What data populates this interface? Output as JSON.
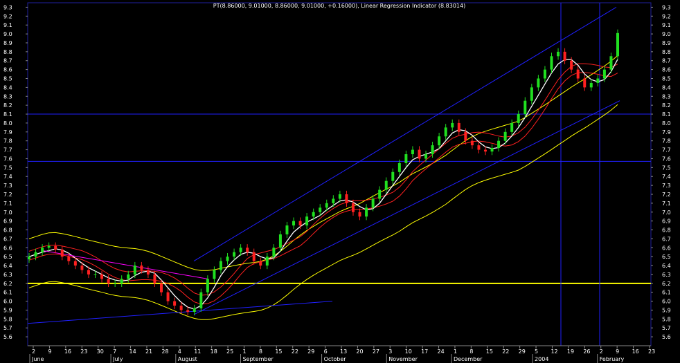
{
  "chart_data": {
    "type": "candlestick",
    "title": "PT(8.86000, 9.01000, 8.86000, 9.01000, +0.16000), Linear Regression Indicator (8.83014)",
    "ylim": [
      5.5,
      9.35
    ],
    "y_ticks": [
      5.6,
      5.7,
      5.8,
      5.9,
      6.0,
      6.1,
      6.2,
      6.3,
      6.4,
      6.5,
      6.6,
      6.7,
      6.8,
      6.9,
      7.0,
      7.1,
      7.2,
      7.3,
      7.4,
      7.5,
      7.6,
      7.7,
      7.8,
      7.9,
      8.0,
      8.1,
      8.2,
      8.3,
      8.4,
      8.5,
      8.6,
      8.7,
      8.8,
      8.9,
      9.0,
      9.1,
      9.2,
      9.3
    ],
    "x_ticks": [
      "2",
      "9",
      "16",
      "23",
      "30",
      "7",
      "14",
      "21",
      "28",
      "4",
      "11",
      "18",
      "25",
      "1",
      "8",
      "15",
      "22",
      "29",
      "6",
      "13",
      "20",
      "27",
      "3",
      "10",
      "17",
      "24",
      "1",
      "8",
      "15",
      "22",
      "29",
      "5",
      "12",
      "19",
      "26",
      "2",
      "9",
      "16",
      "23"
    ],
    "months": [
      "June",
      "July",
      "August",
      "September",
      "October",
      "November",
      "December",
      "2004",
      "February"
    ],
    "horizontal_levels": [
      6.2,
      7.57,
      8.1
    ],
    "close_values": [
      6.5,
      6.55,
      6.6,
      6.62,
      6.58,
      6.5,
      6.45,
      6.4,
      6.35,
      6.3,
      6.3,
      6.25,
      6.2,
      6.2,
      6.25,
      6.3,
      6.4,
      6.35,
      6.3,
      6.2,
      6.1,
      6.0,
      5.95,
      5.9,
      5.88,
      5.92,
      6.1,
      6.25,
      6.35,
      6.45,
      6.5,
      6.55,
      6.6,
      6.55,
      6.45,
      6.4,
      6.5,
      6.6,
      6.75,
      6.85,
      6.9,
      6.85,
      6.95,
      7.0,
      7.05,
      7.1,
      7.15,
      7.2,
      7.1,
      7.0,
      6.95,
      7.05,
      7.15,
      7.25,
      7.35,
      7.45,
      7.55,
      7.65,
      7.7,
      7.6,
      7.65,
      7.75,
      7.85,
      7.95,
      8.0,
      7.9,
      7.8,
      7.75,
      7.7,
      7.68,
      7.72,
      7.8,
      7.9,
      8.0,
      8.1,
      8.25,
      8.4,
      8.5,
      8.6,
      8.75,
      8.8,
      8.7,
      8.6,
      8.5,
      8.4,
      8.45,
      8.5,
      8.6,
      8.75,
      9.01
    ]
  }
}
